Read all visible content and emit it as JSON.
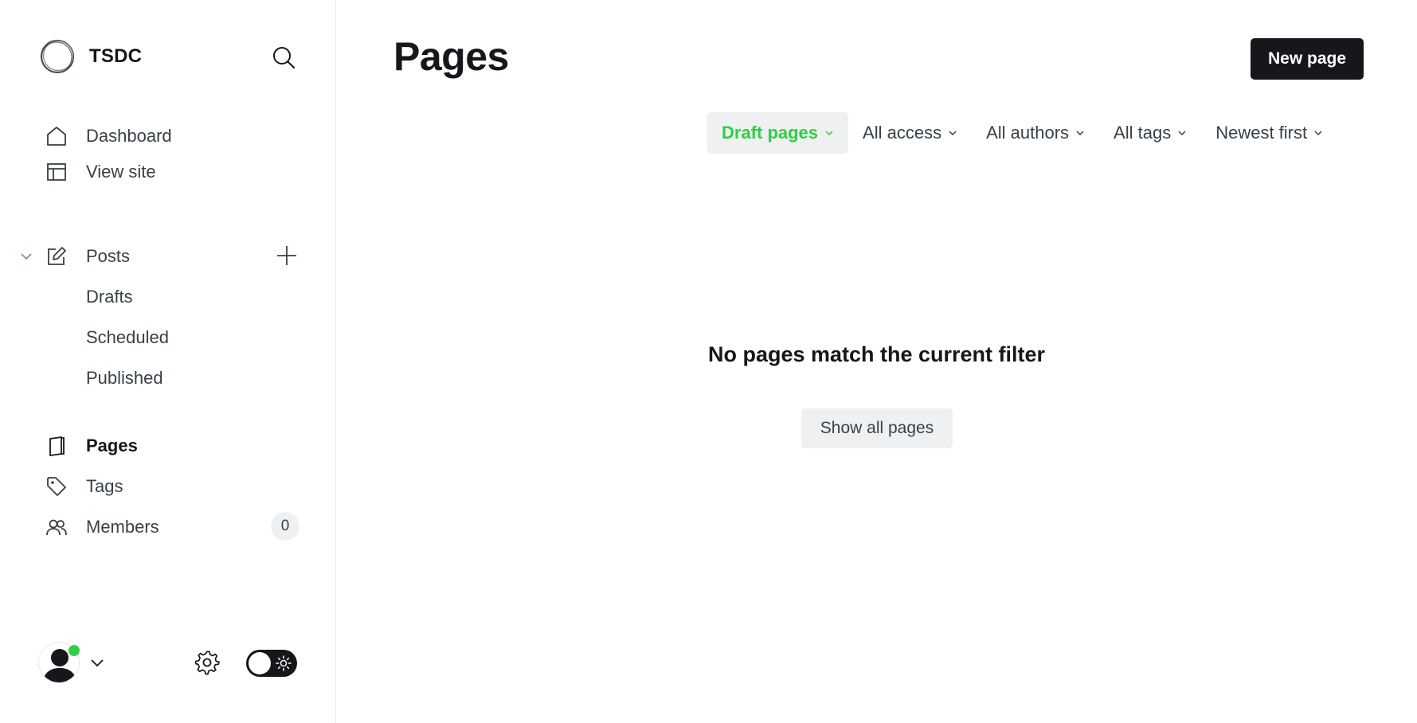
{
  "brand": {
    "name": "TSDC"
  },
  "sidebar": {
    "items": [
      {
        "label": "Dashboard",
        "icon": "home-icon"
      },
      {
        "label": "View site",
        "icon": "layout-icon"
      },
      {
        "label": "Posts",
        "icon": "edit-icon"
      },
      {
        "label": "Drafts"
      },
      {
        "label": "Scheduled"
      },
      {
        "label": "Published"
      },
      {
        "label": "Pages",
        "icon": "page-icon",
        "active": true
      },
      {
        "label": "Tags",
        "icon": "tag-icon"
      },
      {
        "label": "Members",
        "icon": "members-icon",
        "count": "0"
      }
    ]
  },
  "main": {
    "title": "Pages",
    "new_button": "New page",
    "filters": [
      {
        "label": "Draft pages",
        "active": true
      },
      {
        "label": "All access"
      },
      {
        "label": "All authors"
      },
      {
        "label": "All tags"
      },
      {
        "label": "Newest first"
      }
    ],
    "empty_message": "No pages match the current filter",
    "show_all_button": "Show all pages"
  },
  "colors": {
    "accent_green": "#30cf43",
    "dark": "#15171a",
    "light_bg": "#eef0f2"
  }
}
